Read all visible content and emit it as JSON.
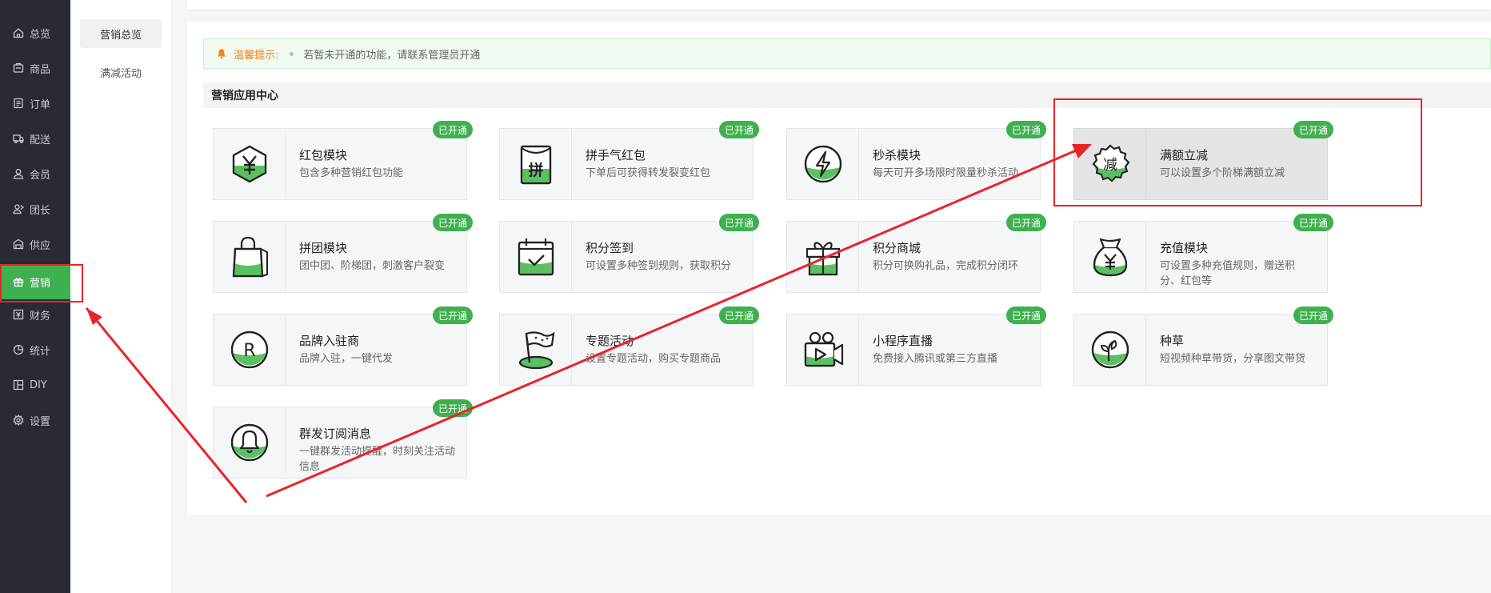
{
  "sidebar": {
    "items": [
      {
        "label": "总览",
        "icon": "home-icon"
      },
      {
        "label": "商品",
        "icon": "goods-icon"
      },
      {
        "label": "订单",
        "icon": "order-icon"
      },
      {
        "label": "配送",
        "icon": "delivery-icon"
      },
      {
        "label": "会员",
        "icon": "member-icon"
      },
      {
        "label": "团长",
        "icon": "leader-icon"
      },
      {
        "label": "供应",
        "icon": "supply-icon"
      },
      {
        "label": "营销",
        "icon": "gift-icon",
        "active": true
      },
      {
        "label": "财务",
        "icon": "finance-icon"
      },
      {
        "label": "统计",
        "icon": "chart-icon"
      },
      {
        "label": "DIY",
        "icon": "diy-icon"
      },
      {
        "label": "设置",
        "icon": "gear-icon"
      }
    ]
  },
  "subnav": {
    "items": [
      {
        "label": "营销总览",
        "active": true
      },
      {
        "label": "满减活动"
      }
    ]
  },
  "tip": {
    "label": "温馨提示:",
    "text": "若暂未开通的功能，请联系管理员开通"
  },
  "section": {
    "title": "营销应用中心"
  },
  "badge_label": "已开通",
  "cards": [
    {
      "title": "红包模块",
      "desc": "包含多种营销红包功能",
      "icon": "yuan-hexagon-icon"
    },
    {
      "title": "拼手气红包",
      "desc": "下单后可获得转发裂变红包",
      "icon": "pin-envelope-icon"
    },
    {
      "title": "秒杀模块",
      "desc": "每天可开多场限时限量秒杀活动",
      "icon": "lightning-icon"
    },
    {
      "title": "满额立减",
      "desc": "可以设置多个阶梯满额立减",
      "icon": "discount-seal-icon"
    },
    {
      "title": "拼团模块",
      "desc": "团中团、阶梯团，刺激客户裂变",
      "icon": "shopping-bag-icon"
    },
    {
      "title": "积分签到",
      "desc": "可设置多种签到规则，获取积分",
      "icon": "calendar-check-icon"
    },
    {
      "title": "积分商城",
      "desc": "积分可换购礼品，完成积分闭环",
      "icon": "gift-box-icon"
    },
    {
      "title": "充值模块",
      "desc": "可设置多种充值规则，赠送积分、红包等",
      "icon": "money-bag-icon"
    },
    {
      "title": "品牌入驻商",
      "desc": "品牌入驻，一键代发",
      "icon": "brand-r-icon"
    },
    {
      "title": "专题活动",
      "desc": "设置专题活动，购买专题商品",
      "icon": "flag-icon"
    },
    {
      "title": "小程序直播",
      "desc": "免费接入腾讯或第三方直播",
      "icon": "video-camera-icon"
    },
    {
      "title": "种草",
      "desc": "短视频种草带货，分享图文带货",
      "icon": "sprout-icon"
    },
    {
      "title": "群发订阅消息",
      "desc": "一键群发活动提醒，时刻关注活动信息",
      "icon": "bell-icon"
    }
  ],
  "colors": {
    "sidebar_bg": "#282a35",
    "accent": "#3fb04f",
    "annotation": "#e8242a",
    "tip_label": "#f5821f"
  }
}
